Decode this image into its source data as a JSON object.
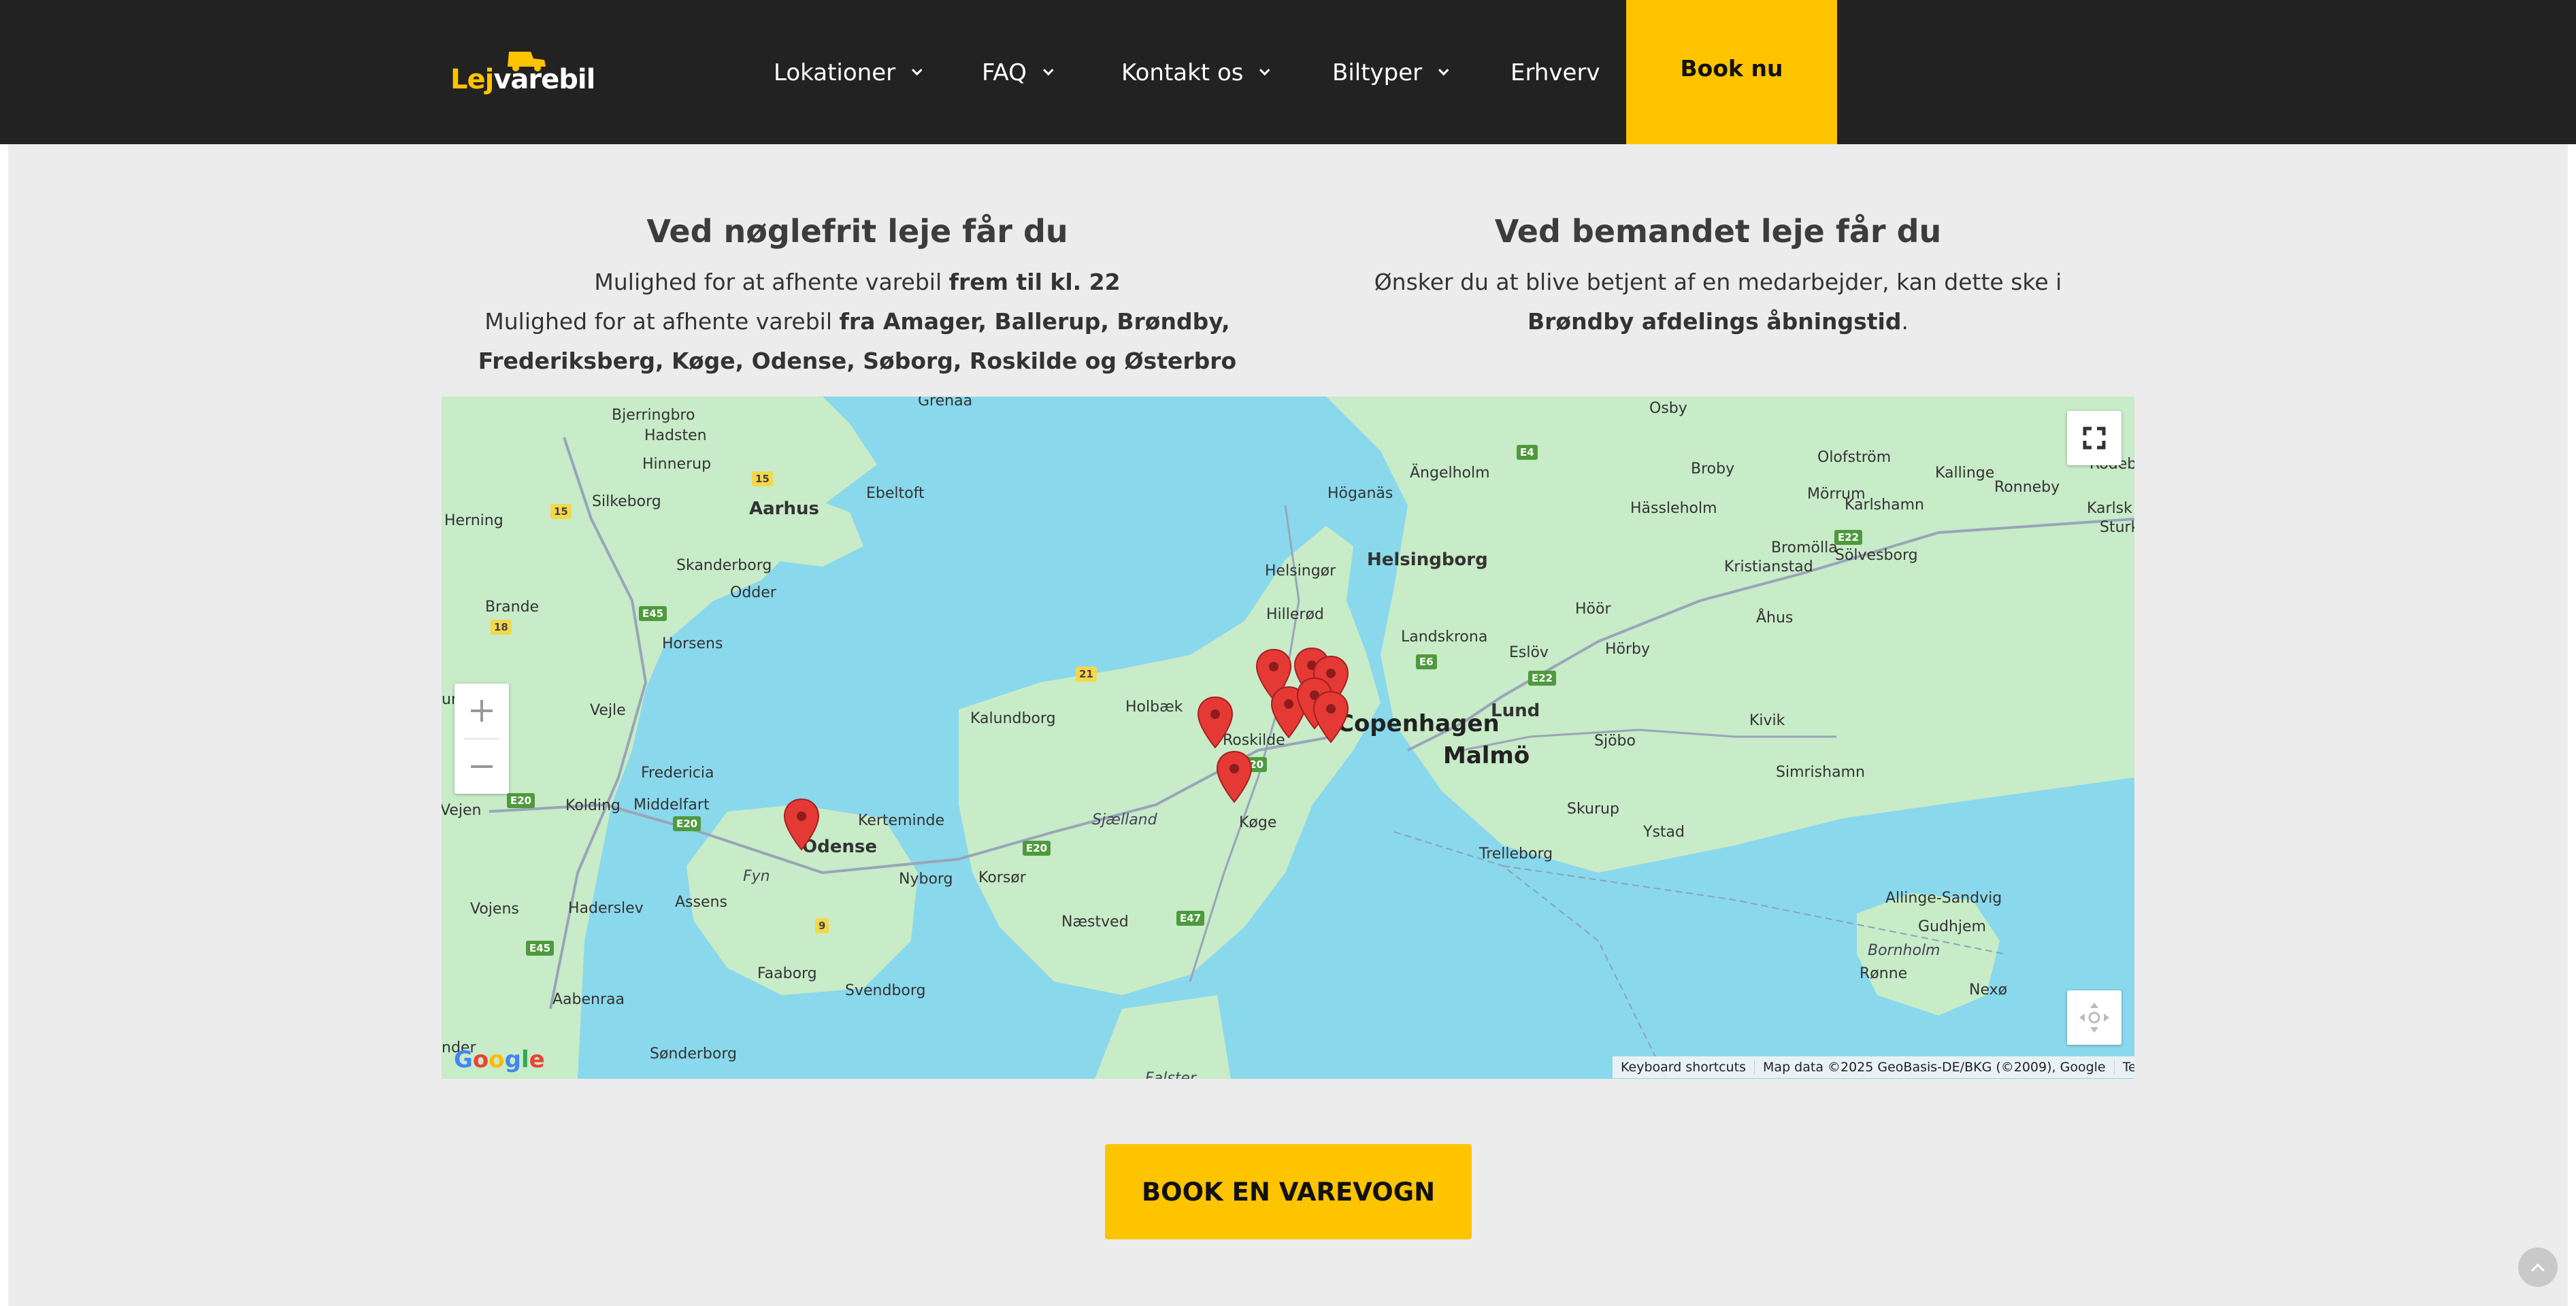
{
  "header": {
    "logo": {
      "part1": "Lej",
      "part2": "varebil"
    },
    "nav": [
      {
        "label": "Lokationer",
        "dropdown": true
      },
      {
        "label": "FAQ",
        "dropdown": true
      },
      {
        "label": "Kontakt os",
        "dropdown": true
      },
      {
        "label": "Biltyper",
        "dropdown": true
      },
      {
        "label": "Erhverv",
        "dropdown": false
      }
    ],
    "book_button": "Book nu"
  },
  "left_column": {
    "title": "Ved nøglefrit leje får du",
    "line1_prefix": "Mulighed for at afhente varebil ",
    "line1_bold": "frem til kl. 22",
    "line2_prefix": "Mulighed for at afhente varebil ",
    "line2_bold_a": "fra Amager, Ballerup, Brøndby,",
    "line2_bold_b": "Frederiksberg, Køge, Odense, Søborg, Roskilde og Østerbro"
  },
  "right_column": {
    "title": "Ved bemandet leje får du",
    "line1": "Ønsker du at blive betjent af en medarbejder, kan dette ske i",
    "line2_bold": "Brøndby afdelings åbningstid",
    "line2_suffix": "."
  },
  "map": {
    "place_labels": {
      "copenhagen": "Copenhagen",
      "malmo": "Malmö",
      "helsingborg": "Helsingborg",
      "lund": "Lund",
      "aarhus": "Aarhus",
      "odense": "Odense",
      "roskilde": "Roskilde",
      "koge": "Køge",
      "sjaelland": "Sjælland",
      "fyn": "Fyn",
      "bornholm": "Bornholm",
      "hillerod": "Hillerød",
      "helsingor": "Helsingør",
      "holbaek": "Holbæk",
      "kalundborg": "Kalundborg",
      "naestved": "Næstved",
      "nyborg": "Nyborg",
      "korsor": "Korsør",
      "svendborg": "Svendborg",
      "faaborg": "Faaborg",
      "kerteminde": "Kerteminde",
      "middelfart": "Middelfart",
      "kolding": "Kolding",
      "fredericia": "Fredericia",
      "vejle": "Vejle",
      "horsens": "Horsens",
      "odder": "Odder",
      "skanderborg": "Skanderborg",
      "silkeborg": "Silkeborg",
      "herning": "Herning",
      "brande": "Brande",
      "ebeltoft": "Ebeltoft",
      "hinnerup": "Hinnerup",
      "hadsten": "Hadsten",
      "bjerringbro": "Bjerringbro",
      "grenaa": "Grenaa",
      "haderslev": "Haderslev",
      "assens": "Assens",
      "vojens": "Vojens",
      "aabenraa": "Aabenraa",
      "sonderborg": "Sønderborg",
      "vejen": "Vejen",
      "hoganas": "Höganäs",
      "angelholm": "Ängelholm",
      "landskrona": "Landskrona",
      "eslov": "Eslöv",
      "hoor": "Höör",
      "horby": "Hörby",
      "sjobo": "Sjöbo",
      "skurup": "Skurup",
      "ystad": "Ystad",
      "trelleborg": "Trelleborg",
      "simrishamn": "Simrishamn",
      "kivik": "Kivik",
      "ahus": "Åhus",
      "kristianstad": "Kristianstad",
      "bromolla": "Bromölla",
      "solvesborg": "Sölvesborg",
      "hassleholm": "Hässleholm",
      "osby": "Osby",
      "broby": "Broby",
      "olofstrom": "Olofström",
      "morrum": "Mörrum",
      "karlshamn": "Karlshamn",
      "kallinge": "Kallinge",
      "ronneby": "Ronneby",
      "rodeby": "Rödeb",
      "karlsk": "Karlsk",
      "sturk": "Sturk",
      "allinge": "Allinge-Sandvig",
      "gudhjem": "Gudhjem",
      "ronne": "Rønne",
      "nexo": "Nexø",
      "falster": "Falster",
      "und": "und",
      "nder": "nder"
    },
    "roads": [
      "15",
      "15",
      "18",
      "E45",
      "21",
      "E4",
      "E6",
      "E22",
      "E22",
      "E20",
      "E20",
      "E20",
      "E20",
      "E47",
      "9",
      "E45",
      "E20"
    ],
    "attribution": {
      "shortcuts": "Keyboard shortcuts",
      "data": "Map data ©2025 GeoBasis-DE/BKG (©2009), Google",
      "terms": "Terms"
    },
    "google_logo": "Google",
    "marker_color": "#e53935"
  },
  "cta": {
    "label": "BOOK EN VAREVOGN"
  },
  "colors": {
    "accent": "#ffc400",
    "header_bg": "#222222",
    "section_bg": "#ececec",
    "water": "#8ad8ec",
    "land": "#c8ebc8"
  }
}
